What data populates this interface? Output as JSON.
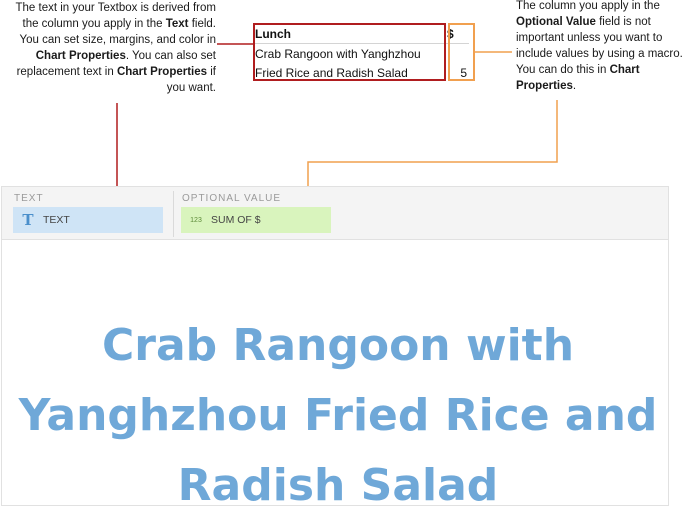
{
  "notes": {
    "left": {
      "p1": "The text in your Textbox is derived from the column you apply in the ",
      "b1": "Text",
      "p2": " field. You can set size, margins, and color in ",
      "b2": "Chart Properties",
      "p3": ". You can also set replacement text in ",
      "b3": "Chart Properties",
      "p4": " if you want."
    },
    "right": {
      "p1": "The column you apply in the ",
      "b1": "Optional Value",
      "p2": " field is not important unless you want to include values by using a macro. You can do this in ",
      "b2": "Chart Properties",
      "p3": "."
    }
  },
  "mini_table": {
    "header": {
      "text": "Lunch",
      "value": "$"
    },
    "rows": [
      {
        "text": "Crab Rangoon with Yanghzhou",
        "value": ""
      },
      {
        "text": "Fried Rice and Radish Salad",
        "value": "5"
      }
    ]
  },
  "field_well": {
    "text_label": "TEXT",
    "text_pill": "TEXT",
    "text_icon": "T",
    "optional_label": "OPTIONAL VALUE",
    "optional_pill": "SUM OF $",
    "optional_icon": "123"
  },
  "canvas": {
    "textbox_content": "Crab Rangoon with Yanghzhou Fried Rice and Radish Salad"
  },
  "colors": {
    "text_highlight": "#b01d1f",
    "value_highlight": "#f1a04f",
    "textbox_text": "#6fa8d8",
    "text_pill_bg": "#cfe4f6",
    "value_pill_bg": "#d9f4bd"
  }
}
